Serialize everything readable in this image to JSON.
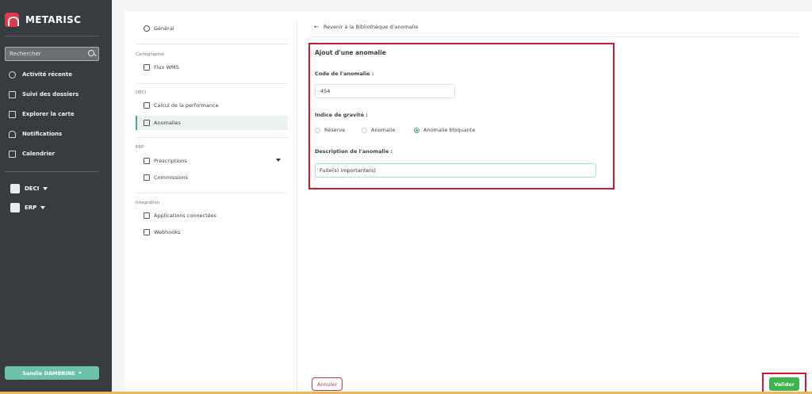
{
  "app": {
    "name": "METARISC"
  },
  "sidebar": {
    "search_placeholder": "Rechercher",
    "nav": [
      {
        "label": "Activité récente",
        "icon": "activity-icon"
      },
      {
        "label": "Suivi des dossiers",
        "icon": "folder-icon"
      },
      {
        "label": "Explorer la carte",
        "icon": "map-icon"
      },
      {
        "label": "Notifications",
        "icon": "bell-icon"
      },
      {
        "label": "Calendrier",
        "icon": "calendar-icon"
      }
    ],
    "groups": [
      {
        "label": "DECI",
        "icon": "hydrant-icon"
      },
      {
        "label": "ERP",
        "icon": "building-icon"
      }
    ],
    "user": "Sandie DAMBRINE"
  },
  "settings": {
    "general": "Général",
    "cartographie_title": "Cartographie",
    "flux_wms": "Flux WMS",
    "deci_title": "DECI",
    "calcul": "Calcul de la performance",
    "anomalies": "Anomalies",
    "erp_title": "ERP",
    "prescriptions": "Prescriptions",
    "commissions": "Commissions",
    "integration_title": "Intégration",
    "applications": "Applications connectées",
    "webhooks": "Webhooks"
  },
  "form": {
    "back": "Revenir à la Bibliothèque d'anomalie",
    "title": "Ajout d'une anomalie",
    "code_label": "Code de l'anomalie :",
    "code_value": "454",
    "gravity_label": "Indice de gravité :",
    "gravity_options": [
      "Réserve",
      "Anomalie",
      "Anomalie bloquante"
    ],
    "gravity_selected": "Anomalie bloquante",
    "desc_label": "Description de l'anomalie :",
    "desc_value": "Fuite(s) importante(s)",
    "cancel": "Annuler",
    "submit": "Valider"
  },
  "colors": {
    "sidebar_bg": "#383c40",
    "accent": "#4aa88b",
    "highlight": "#d4152c",
    "submit": "#3cb44b",
    "cancel": "#cc3344"
  }
}
